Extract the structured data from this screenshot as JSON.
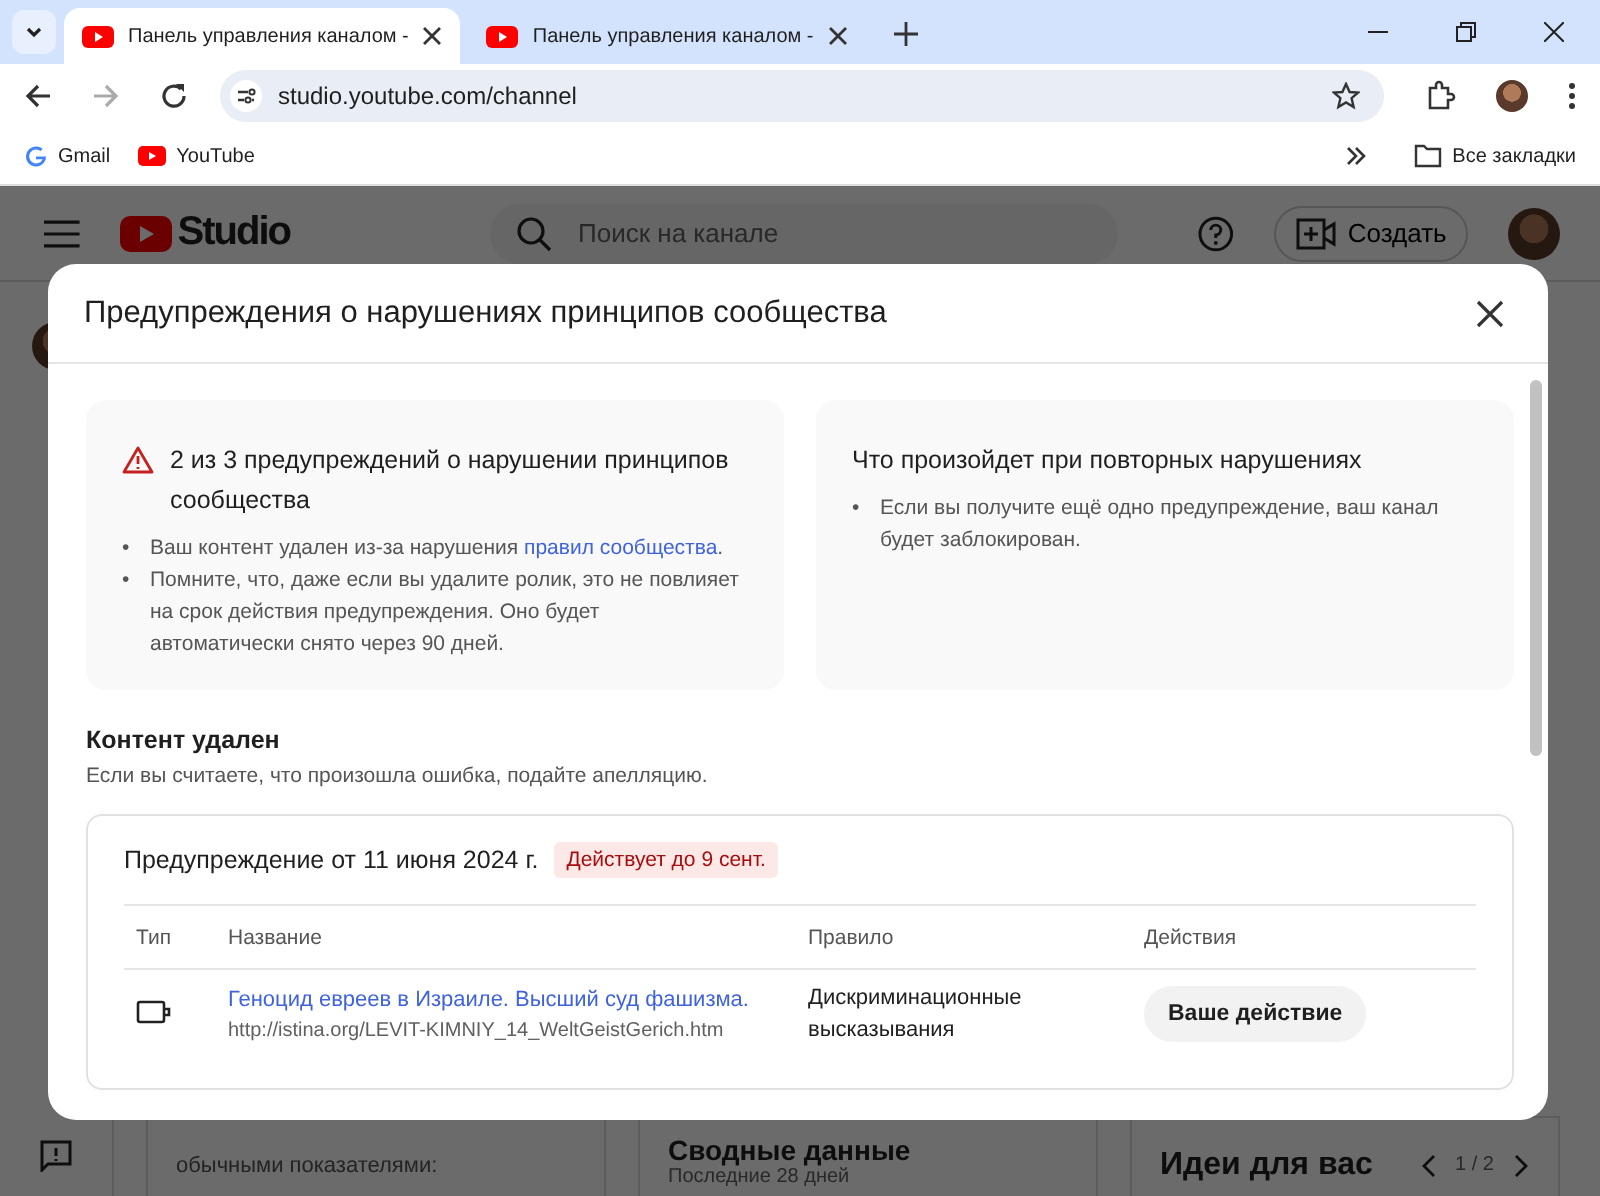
{
  "browser": {
    "tabs": [
      {
        "title": "Панель управления каналом -",
        "selected": true
      },
      {
        "title": "Панель управления каналом -",
        "selected": false
      }
    ],
    "url": "studio.youtube.com/channel",
    "bookmarks": [
      {
        "label": "Gmail",
        "kind": "google"
      },
      {
        "label": "YouTube",
        "kind": "youtube"
      }
    ],
    "all_bookmarks": "Все закладки"
  },
  "studio": {
    "logo": "Studio",
    "search": {
      "placeholder": "Поиск на канале"
    },
    "create_button": "Создать",
    "background": {
      "left_text": "обычными показателями:",
      "summary_title": "Сводные данные",
      "summary_period": "Последние 28 дней",
      "ideas_title": "Идеи для вас",
      "pager": "1 / 2"
    }
  },
  "dialog": {
    "title": "Предупреждения о нарушениях принципов сообщества",
    "strike_card": {
      "heading": "2 из 3 предупреждений о нарушении принципов сообщества",
      "bullets": [
        {
          "marker": "•",
          "text": "Ваш контент удален из-за нарушения ",
          "link": "правил сообщества",
          "after": "."
        },
        {
          "marker": "•",
          "text": "Помните, что, даже если вы удалите ролик, это не повлияет на срок действия предупреждения. Оно будет автоматически снято через 90 дней."
        }
      ]
    },
    "repeat_card": {
      "heading": "Что произойдет при повторных нарушениях",
      "bullets": [
        {
          "marker": "•",
          "text": "Если вы получите ещё одно предупреждение, ваш канал будет заблокирован."
        }
      ]
    },
    "section_title": "Контент удален",
    "section_subtitle": "Если вы считаете, что произошла ошибка, подайте апелляцию.",
    "strike": {
      "heading": "Предупреждение от 11 июня 2024 г.",
      "badge": "Действует до 9 сент.",
      "columns": [
        "Тип",
        "Название",
        "Правило",
        "Действия"
      ],
      "rows": [
        {
          "title": "Геноцид евреев в Израиле. Высший суд фашизма.",
          "url": "http://istina.org/LEVIT-KIMNIY_14_WeltGeistGerich.htm",
          "rule": "Дискриминационные высказывания",
          "action": "Ваше действие"
        }
      ]
    }
  }
}
